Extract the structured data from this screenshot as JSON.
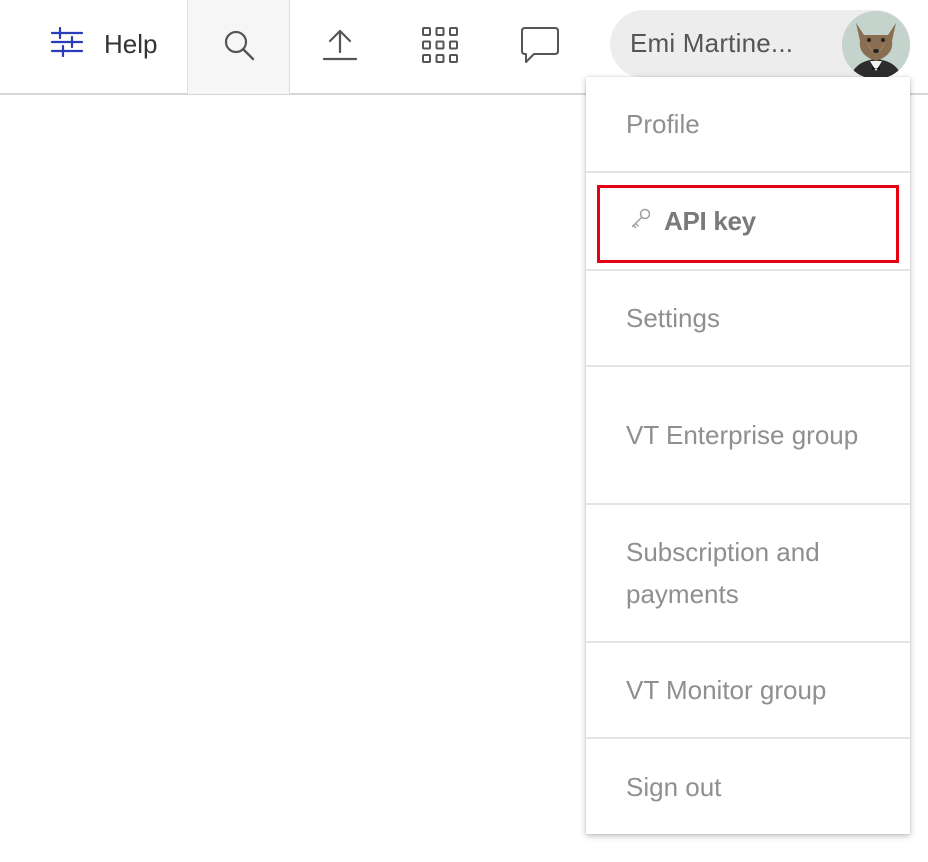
{
  "header": {
    "help_label": "Help"
  },
  "user": {
    "name": "Emi Martine..."
  },
  "menu": {
    "items": [
      {
        "label": "Profile"
      },
      {
        "label": "API key"
      },
      {
        "label": "Settings"
      },
      {
        "label": "VT Enterprise group"
      },
      {
        "label": "Subscription and payments"
      },
      {
        "label": "VT Monitor group"
      },
      {
        "label": "Sign out"
      }
    ]
  },
  "colors": {
    "accent": "#2a3cb7",
    "highlight": "#e60012",
    "menu_text": "#8f8f8f"
  },
  "icons": [
    "sliders-icon",
    "search-icon",
    "upload-icon",
    "apps-grid-icon",
    "chat-icon",
    "key-icon"
  ]
}
